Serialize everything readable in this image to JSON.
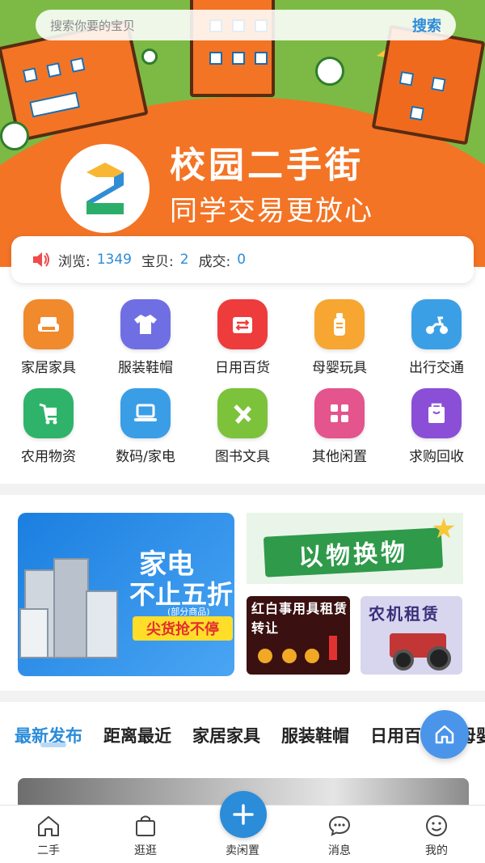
{
  "search": {
    "placeholder": "搜索你要的宝贝",
    "button_label": "搜索"
  },
  "hero": {
    "title": "校园二手街",
    "subtitle": "同学交易更放心"
  },
  "stats": {
    "views_label": "浏览:",
    "views_value": "1349",
    "items_label": "宝贝:",
    "items_value": "2",
    "deals_label": "成交:",
    "deals_value": "0"
  },
  "categories": [
    {
      "label": "家居家具",
      "icon": "sofa-icon",
      "color": "#f08a2c"
    },
    {
      "label": "服装鞋帽",
      "icon": "tshirt-icon",
      "color": "#6f6fe3"
    },
    {
      "label": "日用百货",
      "icon": "basket-icon",
      "color": "#ee3b3b"
    },
    {
      "label": "母婴玩具",
      "icon": "baby-bottle-icon",
      "color": "#f6a631"
    },
    {
      "label": "出行交通",
      "icon": "scooter-icon",
      "color": "#3b9fe6"
    },
    {
      "label": "农用物资",
      "icon": "cart-icon",
      "color": "#2fb36a"
    },
    {
      "label": "数码/家电",
      "icon": "laptop-icon",
      "color": "#3a9ee6"
    },
    {
      "label": "图书文具",
      "icon": "pencil-ruler-icon",
      "color": "#7cc23a"
    },
    {
      "label": "其他闲置",
      "icon": "grid-icon",
      "color": "#e4548d"
    },
    {
      "label": "求购回收",
      "icon": "bag-icon",
      "color": "#8a4fd6"
    }
  ],
  "banners": {
    "appliance": {
      "line1": "家电",
      "line2": "不止五折",
      "note": "(部分商品)",
      "tag": "尖货抢不停"
    },
    "swap": {
      "title": "以物换物"
    },
    "rent": {
      "title": "红白事用具租赁转让"
    },
    "farm": {
      "title": "农机租赁"
    }
  },
  "tabs": [
    "最新发布",
    "距离最近",
    "家居家具",
    "服装鞋帽",
    "日用百货",
    "母婴玩具"
  ],
  "nav": [
    {
      "label": "二手",
      "icon": "home-icon"
    },
    {
      "label": "逛逛",
      "icon": "shopping-bag-icon"
    },
    {
      "label": "卖闲置",
      "icon": "plus-icon"
    },
    {
      "label": "消息",
      "icon": "chat-icon"
    },
    {
      "label": "我的",
      "icon": "smile-icon"
    }
  ],
  "colors": {
    "accent": "#2b8cd9",
    "hero_green": "#7cba45",
    "hero_orange": "#f37425"
  }
}
